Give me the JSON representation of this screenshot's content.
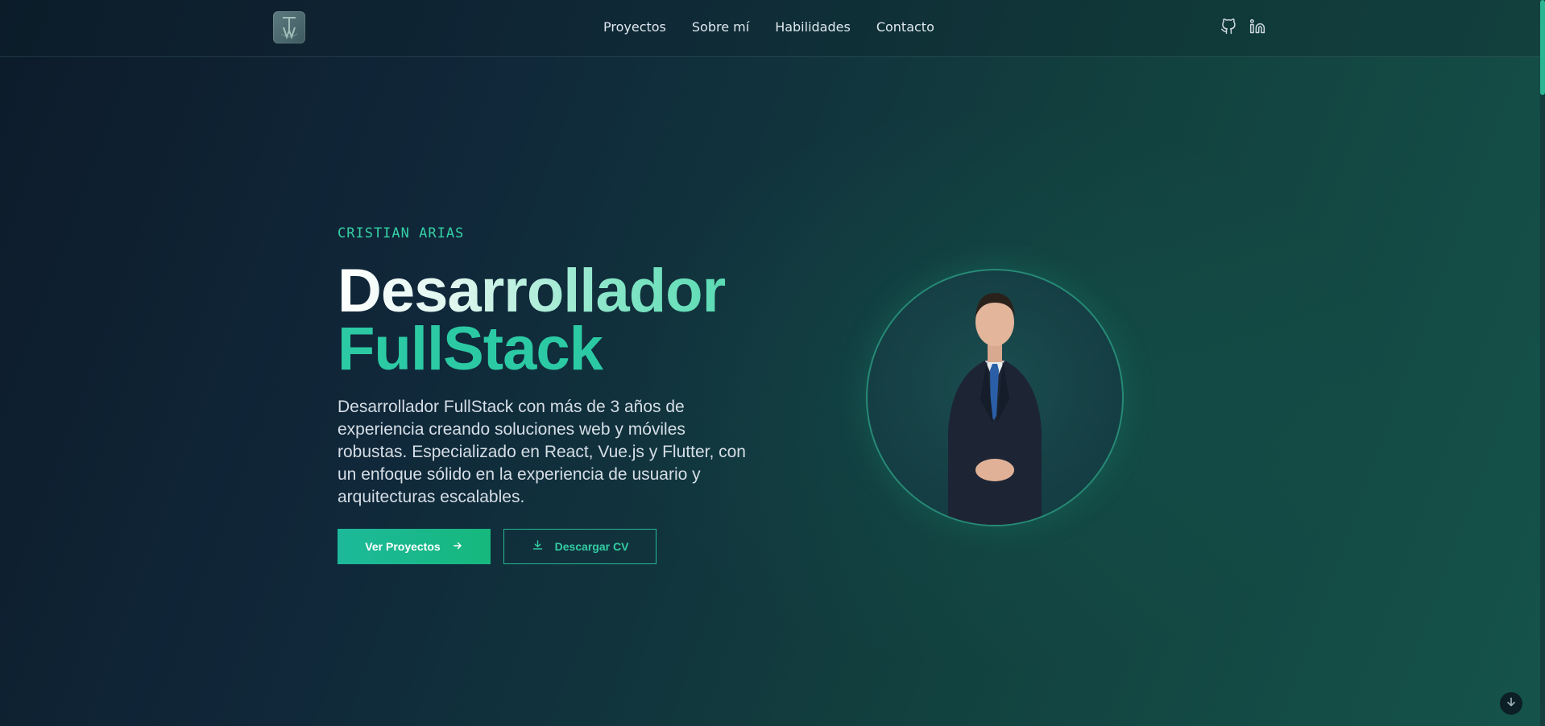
{
  "nav": {
    "items": [
      {
        "label": "Proyectos"
      },
      {
        "label": "Sobre mí"
      },
      {
        "label": "Habilidades"
      },
      {
        "label": "Contacto"
      }
    ]
  },
  "social": {
    "icons": [
      "github-icon",
      "linkedin-icon"
    ]
  },
  "hero": {
    "eyebrow": "CRISTIAN ARIAS",
    "title_line1": "Desarrollador",
    "title_line2": "FullStack",
    "description": "Desarrollador FullStack con más de 3 años de experiencia creando soluciones web y móviles robustas. Especializado en React, Vue.js y Flutter, con un enfoque sólido en la experiencia de usuario y arquitecturas escalables.",
    "primary_button": "Ver Proyectos",
    "secondary_button": "Descargar CV"
  },
  "colors": {
    "accent": "#2ccaa4",
    "background_dark": "#0d1b2a",
    "background_teal": "#15534a"
  }
}
